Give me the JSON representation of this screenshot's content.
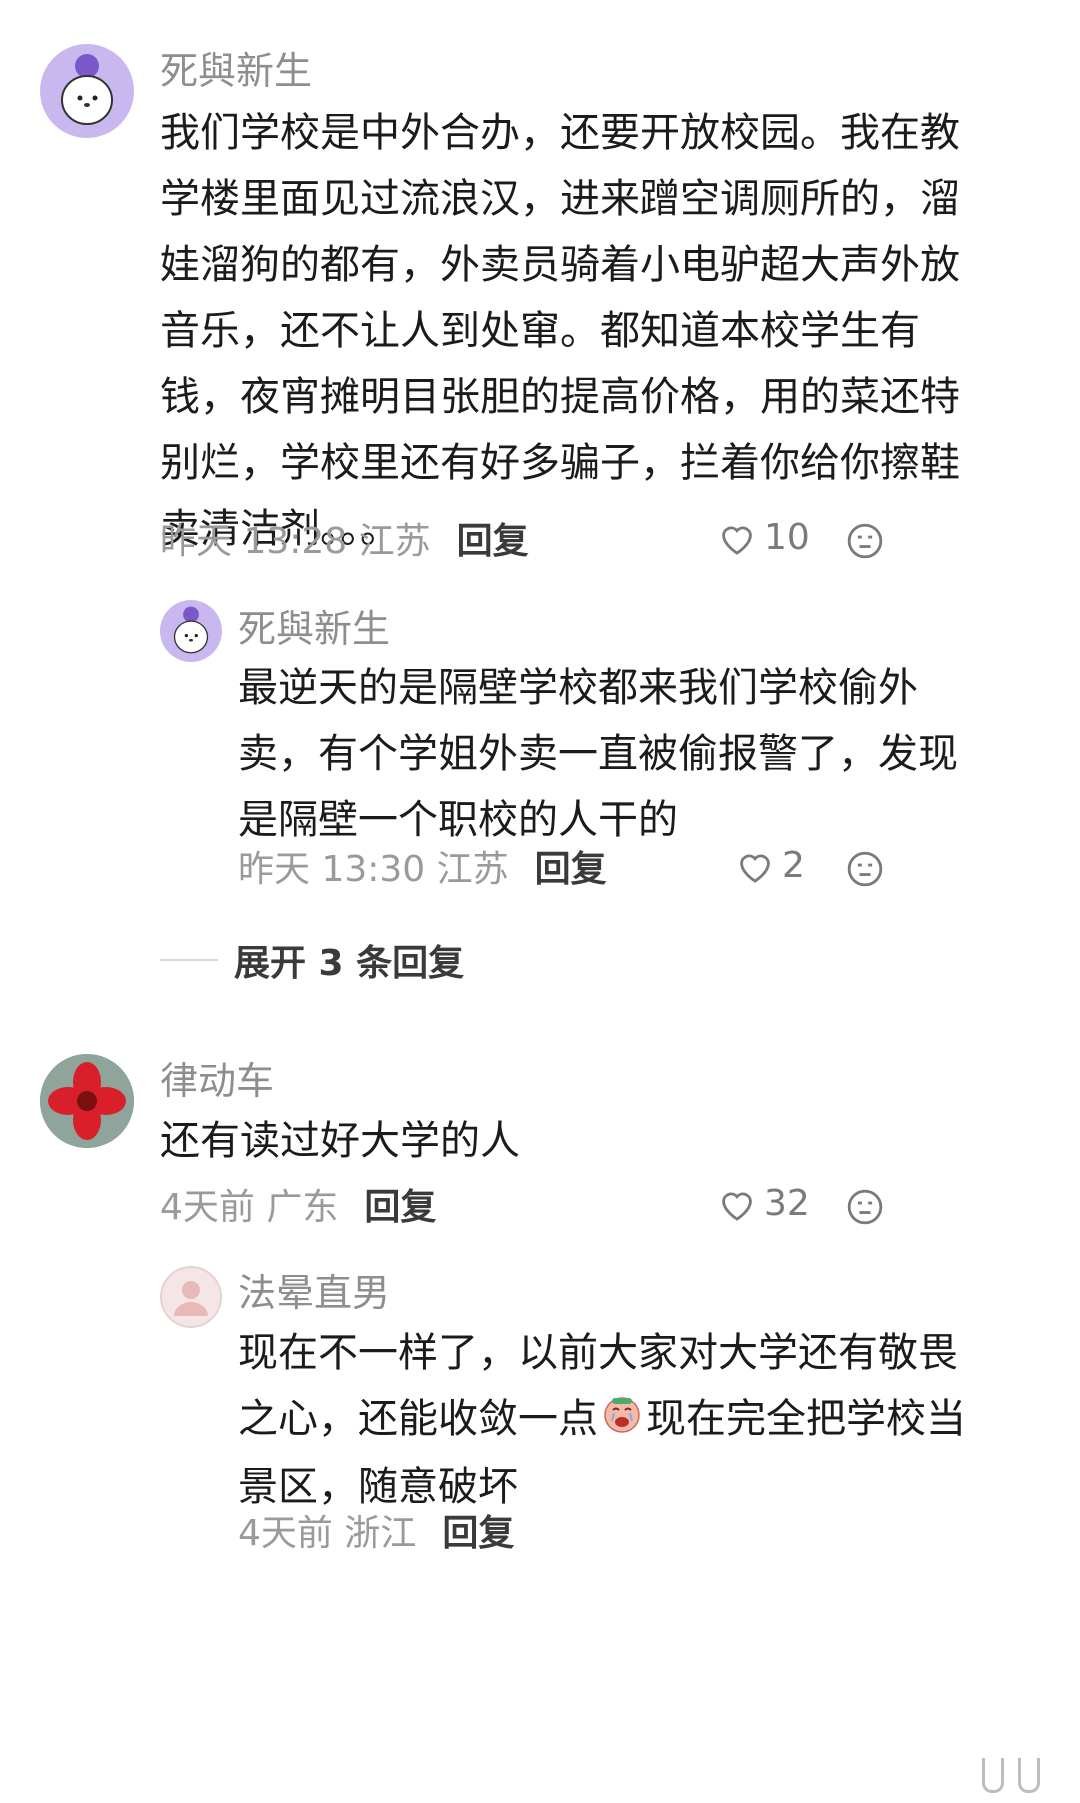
{
  "comments": [
    {
      "username": "死與新生",
      "lines": [
        "我们学校是中外合办，还要开放校园。我在教",
        "学楼里面见过流浪汉，进来蹭空调厕所的，溜",
        "娃溜狗的都有，外卖员骑着小电驴超大声外放",
        "音乐，还不让人到处窜。都知道本校学生有",
        "钱，夜宵摊明目张胆的提高价格，用的菜还特",
        "别烂，学校里还有好多骗子，拦着你给你擦鞋",
        "卖清洁剂。。。"
      ],
      "time": "昨天 13:28 江苏",
      "reply": "回复",
      "likes": "10",
      "replies": [
        {
          "username": "死與新生",
          "lines": [
            "最逆天的是隔壁学校都来我们学校偷外",
            "卖，有个学姐外卖一直被偷报警了，发现",
            "是隔壁一个职校的人干的"
          ],
          "time": "昨天 13:30 江苏",
          "reply": "回复",
          "likes": "2"
        }
      ],
      "expand_label": "展开 3 条回复"
    },
    {
      "username": "律动车",
      "lines": [
        "还有读过好大学的人"
      ],
      "time": "4天前 广东",
      "reply": "回复",
      "likes": "32",
      "replies": [
        {
          "username": "法晕直男",
          "line1": "现在不一样了，以前大家对大学还有敬畏",
          "line2a": "之心，还能收敛一点",
          "line2b": "现在完全把学校当",
          "line3": "景区，随意破坏",
          "time": "4天前 浙江",
          "reply": "回复"
        }
      ]
    }
  ],
  "icons": {
    "like": "heart-outline-icon",
    "dislike": "neutral-face-icon",
    "inline_emoji": "crying-face-emoji"
  },
  "colors": {
    "username": "#8e8e8e",
    "text": "#1b1b1b",
    "meta": "#9a9a9a",
    "avatar_bg": "#c9b8f0"
  }
}
